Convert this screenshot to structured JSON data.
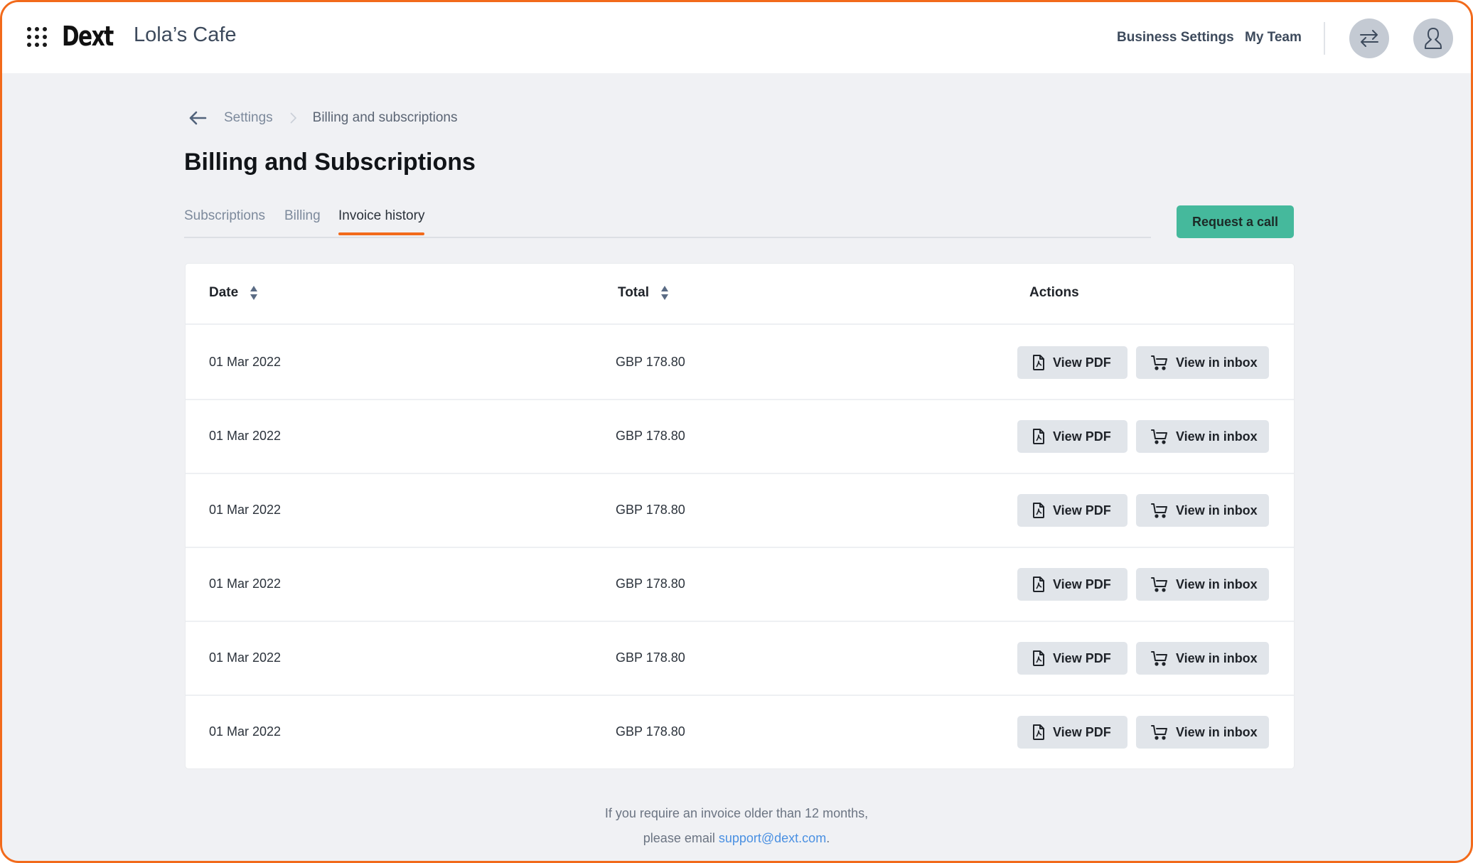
{
  "header": {
    "logo": "Dext",
    "company_name": "Lola’s Cafe",
    "nav": [
      {
        "label": "Business Settings"
      },
      {
        "label": "My Team"
      }
    ],
    "icons": {
      "apps": "grid-icon",
      "switch": "swap-arrows-icon",
      "account": "user-icon"
    }
  },
  "breadcrumb": {
    "back_icon": "arrow-left-icon",
    "items": [
      {
        "label": "Settings"
      },
      {
        "label": "Billing and subscriptions"
      }
    ]
  },
  "page": {
    "title": "Billing and Subscriptions"
  },
  "tabs": [
    {
      "label": "Subscriptions",
      "active": false
    },
    {
      "label": "Billing",
      "active": false
    },
    {
      "label": "Invoice history",
      "active": true
    }
  ],
  "actions": {
    "request_call": "Request a call"
  },
  "table": {
    "columns": [
      {
        "label": "Date",
        "sortable": true
      },
      {
        "label": "Total",
        "sortable": true
      },
      {
        "label": "Actions",
        "sortable": false
      }
    ],
    "row_actions": {
      "view_pdf": "View PDF",
      "view_inbox": "View in inbox"
    },
    "rows": [
      {
        "date": "01 Mar 2022",
        "total": "GBP 178.80"
      },
      {
        "date": "01 Mar 2022",
        "total": "GBP 178.80"
      },
      {
        "date": "01 Mar 2022",
        "total": "GBP 178.80"
      },
      {
        "date": "01 Mar 2022",
        "total": "GBP 178.80"
      },
      {
        "date": "01 Mar 2022",
        "total": "GBP 178.80"
      },
      {
        "date": "01 Mar 2022",
        "total": "GBP 178.80"
      }
    ]
  },
  "footer": {
    "line1": "If you require an invoice older than 12 months,",
    "line2_prefix": "please email ",
    "email": "support@dext.com",
    "line2_suffix": "."
  },
  "colors": {
    "accent": "#f26a1b",
    "primary_button": "#45b99c",
    "link": "#4a90e2"
  }
}
